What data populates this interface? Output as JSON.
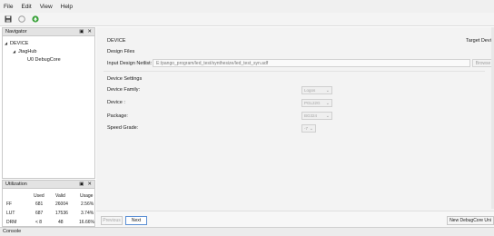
{
  "menubar": {
    "items": [
      "File",
      "Edit",
      "View",
      "Help"
    ]
  },
  "toolbar": {
    "buttons": [
      "save-icon",
      "undo-icon",
      "run-icon"
    ]
  },
  "navigator": {
    "title": "Navigator",
    "tree": [
      {
        "label": "DEVICE",
        "level": 0
      },
      {
        "label": "JtagHub",
        "level": 1
      },
      {
        "label": "U0 DebugCore",
        "level": 2
      }
    ]
  },
  "utilization": {
    "title": "Utilization",
    "headers": [
      "",
      "Used",
      "Valid",
      "Usage"
    ],
    "rows": [
      [
        "FF",
        "681",
        "26004",
        "2.56%"
      ],
      [
        "LUT",
        "687",
        "17536",
        "3.74%"
      ],
      [
        "DRM",
        "< 8",
        "48",
        "16.66%"
      ]
    ]
  },
  "main": {
    "device_heading": "DEVICE",
    "target_device_label": "Target Devic",
    "design_files_heading": "Design Files",
    "netlist_label": "Input Design Netlist:",
    "netlist_value": "E:/pango_program/led_test/synthesize/led_test_syn.adf",
    "browse_label": "Browse",
    "device_settings_heading": "Device Settings",
    "fields": [
      {
        "label": "Device Family:",
        "value": "Logos"
      },
      {
        "label": "Device :",
        "value": "PGL22G"
      },
      {
        "label": "Package:",
        "value": "BG324"
      },
      {
        "label": "Speed Grade:",
        "value": "-7"
      }
    ]
  },
  "footer": {
    "previous_label": "Previous",
    "next_label": "Next",
    "new_label": "New DebugCore Uni"
  },
  "status": {
    "text": "Console"
  }
}
